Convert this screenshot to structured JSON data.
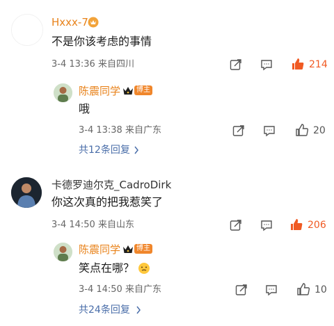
{
  "comments": [
    {
      "username": "Hxxx-7",
      "text": "不是你该考虑的事情",
      "date": "3-4 13:36",
      "location": "来自四川",
      "likes": "214",
      "reply": {
        "username": "陈震同学",
        "badge": "博主",
        "text": "哦",
        "date": "3-4 13:38",
        "location": "来自广东",
        "likes": "20"
      },
      "more_replies": "共12条回复"
    },
    {
      "username": "卡德罗迪尔克_CadroDirk",
      "text": "你这次真的把我惹笑了",
      "date": "3-4 14:50",
      "location": "来自山东",
      "likes": "206",
      "reply": {
        "username": "陈震同学",
        "badge": "博主",
        "text": "笑点在哪？",
        "date": "3-4 14:50",
        "location": "来自广东",
        "likes": "10"
      },
      "more_replies": "共24条回复"
    }
  ],
  "colors": {
    "accent": "#f05a23",
    "link": "#4a6ea9",
    "blogger": "#e8821a"
  },
  "icons": [
    "share-icon",
    "comment-icon",
    "like-icon",
    "crown-badge-icon",
    "vip-badge-icon",
    "chevron-right-icon",
    "emoji-icon"
  ]
}
